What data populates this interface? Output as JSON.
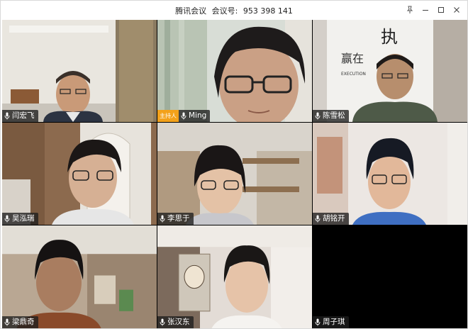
{
  "window": {
    "app_title": "腾讯会议",
    "meeting_id_label": "会议号:",
    "meeting_id": "953 398 141"
  },
  "controls": {
    "pin_icon": "pin-icon",
    "minimize_icon": "minimize-icon",
    "maximize_icon": "maximize-icon",
    "close_icon": "close-icon"
  },
  "participants": [
    {
      "name": "闫宏飞",
      "host": false,
      "mic": "mic-icon"
    },
    {
      "name": "Ming",
      "host": true,
      "host_label": "主持人",
      "mic": "mic-icon"
    },
    {
      "name": "陈雪松",
      "host": false,
      "mic": "mic-icon"
    },
    {
      "name": "吴泓瑞",
      "host": false,
      "mic": "mic-icon"
    },
    {
      "name": "李思于",
      "host": false,
      "mic": "mic-icon"
    },
    {
      "name": "胡铭开",
      "host": false,
      "mic": "mic-icon"
    },
    {
      "name": "梁鼎奇",
      "host": false,
      "mic": "mic-icon"
    },
    {
      "name": "张汉东",
      "host": false,
      "mic": "mic-icon"
    },
    {
      "name": "周子琪",
      "host": false,
      "mic": "mic-icon"
    }
  ],
  "backgrounds": {
    "poster_text_1": "执",
    "poster_text_2": "赢在",
    "poster_text_3": "EXECUTION"
  }
}
